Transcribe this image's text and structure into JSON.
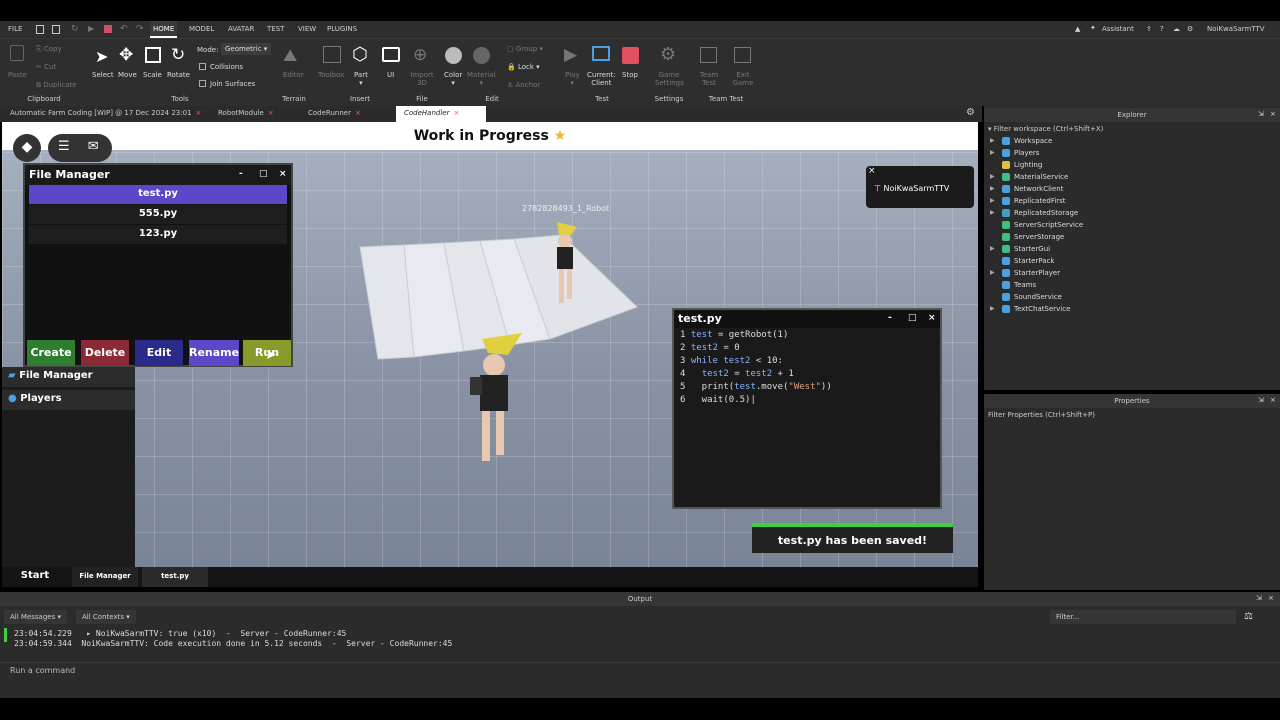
{
  "menubar": {
    "items": [
      "FILE",
      "HOME",
      "MODEL",
      "AVATAR",
      "TEST",
      "VIEW",
      "PLUGINS"
    ],
    "active": "HOME",
    "assistant": "Assistant",
    "user": "NoiKwaSarmTTV"
  },
  "ribbon": {
    "clipboard": {
      "paste": "Paste",
      "copy": "Copy",
      "cut": "Cut",
      "duplicate": "Duplicate",
      "group": "Clipboard"
    },
    "tools": {
      "select": "Select",
      "move": "Move",
      "scale": "Scale",
      "rotate": "Rotate",
      "mode_label": "Mode:",
      "mode_value": "Geometric",
      "collisions": "Collisions",
      "join": "Join Surfaces",
      "group": "Tools"
    },
    "terrain": {
      "editor": "Editor",
      "group": "Terrain"
    },
    "insert": {
      "toolbox": "Toolbox",
      "part": "Part",
      "ui": "UI",
      "group": "Insert"
    },
    "file": {
      "import3d": "Import 3D",
      "group": "File"
    },
    "edit": {
      "color": "Color",
      "material": "Material",
      "group_btn": "Group",
      "lock": "Lock",
      "anchor": "Anchor",
      "group": "Edit"
    },
    "test": {
      "play": "Play",
      "current": "Current:",
      "client": "Client",
      "stop": "Stop",
      "group": "Test"
    },
    "settings": {
      "game_settings": "Game Settings",
      "group": "Settings"
    },
    "team_test": {
      "team_test": "Team Test",
      "exit_game": "Exit Game",
      "group": "Team Test"
    }
  },
  "tabs": [
    {
      "label": "Automatic Farm Coding [WIP] @ 17 Dec 2024 23:01",
      "close": "×"
    },
    {
      "label": "RobotModule",
      "close": "×"
    },
    {
      "label": "CodeRunner",
      "close": "×"
    },
    {
      "label": "CodeHandler",
      "close": "×"
    }
  ],
  "viewport": {
    "title": "Work in Progress",
    "robot_label": "2782828493_1_Robot",
    "notif_user": "NoiKwaSarmTTV",
    "notif_close": "×"
  },
  "file_manager": {
    "title": "File Manager",
    "min": "-",
    "max": "□",
    "close": "×",
    "files": [
      "test.py",
      "555.py",
      "123.py"
    ],
    "buttons": {
      "create": "Create",
      "delete": "Delete",
      "edit": "Edit",
      "rename": "Rename",
      "run": "Run"
    },
    "colors": {
      "create": "#2f7d2f",
      "delete": "#8b2a35",
      "edit": "#2a2a8a",
      "rename": "#5a48c8",
      "run": "#8a9a2a"
    }
  },
  "left_panel": {
    "file_manager": "File Manager",
    "players": "Players"
  },
  "bottom_tabs": {
    "start": "Start",
    "file_manager": "File Manager",
    "test": "test.py"
  },
  "editor": {
    "title": "test.py",
    "min": "-",
    "max": "□",
    "close": "×",
    "line_numbers": [
      "1",
      "2",
      "3",
      "4",
      "5",
      "6"
    ]
  },
  "toast": {
    "text": "test.py has been saved!"
  },
  "explorer": {
    "title": "Explorer",
    "filter": "Filter workspace (Ctrl+Shift+X)",
    "items": [
      "Workspace",
      "Players",
      "Lighting",
      "MaterialService",
      "NetworkClient",
      "ReplicatedFirst",
      "ReplicatedStorage",
      "ServerScriptService",
      "ServerStorage",
      "StarterGui",
      "StarterPack",
      "StarterPlayer",
      "Teams",
      "SoundService",
      "TextChatService"
    ],
    "icon_colors": [
      "#4aa0e0",
      "#4aa0e0",
      "#e0c040",
      "#40c080",
      "#4aa0e0",
      "#4aa0e0",
      "#40a0c0",
      "#40c080",
      "#40c080",
      "#40c080",
      "#4aa0e0",
      "#4aa0e0",
      "#4aa0e0",
      "#4aa0e0",
      "#4aa0e0"
    ]
  },
  "properties": {
    "title": "Properties",
    "filter": "Filter Properties (Ctrl+Shift+P)"
  },
  "output": {
    "title": "Output",
    "all_messages": "All Messages",
    "all_contexts": "All Contexts",
    "filter": "Filter...",
    "lines": [
      "23:04:54.229   ▸ NoiKwaSarmTTV: true (x10)  -  Server - CodeRunner:45",
      "23:04:59.344  NoiKwaSarmTTV: Code execution done in 5.12 seconds  -  Server - CodeRunner:45"
    ],
    "command_placeholder": "Run a command"
  }
}
